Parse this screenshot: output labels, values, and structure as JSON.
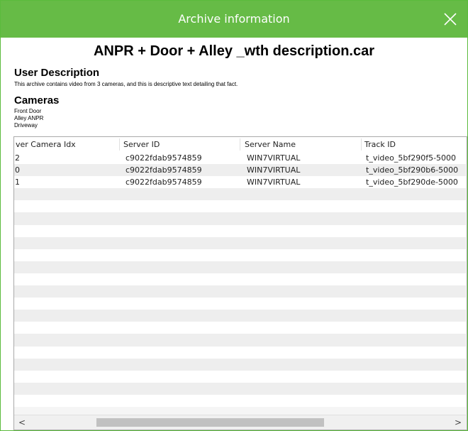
{
  "window": {
    "title": "Archive information",
    "close_icon": "close-icon"
  },
  "archive": {
    "name": "ANPR + Door + Alley _wth description.car"
  },
  "user_description": {
    "heading": "User Description",
    "text": "This archive contains video from 3 cameras, and this is descriptive text detailing that fact."
  },
  "cameras": {
    "heading": "Cameras",
    "list": [
      "Front Door",
      "Alley ANPR",
      "Driveway"
    ]
  },
  "table": {
    "columns": [
      "ver Camera Idx",
      "Server ID",
      "Server Name",
      "Track ID"
    ],
    "rows": [
      [
        "2",
        "c9022fdab9574859",
        "WIN7VIRTUAL",
        "t_video_5bf290f5-5000"
      ],
      [
        "0",
        "c9022fdab9574859",
        "WIN7VIRTUAL",
        "t_video_5bf290b6-5000"
      ],
      [
        "1",
        "c9022fdab9574859",
        "WIN7VIRTUAL",
        "t_video_5bf290de-5000"
      ]
    ]
  },
  "scrollbar": {
    "left_arrow": "<",
    "right_arrow": ">"
  },
  "colors": {
    "titlebar": "#66bb46",
    "border": "#5bbb3c",
    "row_alt": "#eeeeee"
  }
}
